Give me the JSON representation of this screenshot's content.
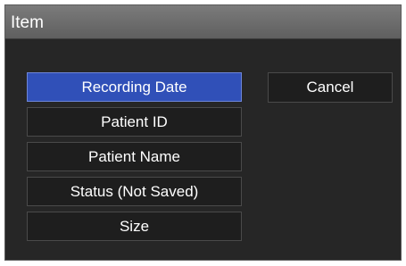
{
  "dialog": {
    "title": "Item",
    "items": [
      {
        "label": "Recording Date",
        "selected": true
      },
      {
        "label": "Patient ID",
        "selected": false
      },
      {
        "label": "Patient Name",
        "selected": false
      },
      {
        "label": "Status (Not Saved)",
        "selected": false
      },
      {
        "label": "Size",
        "selected": false
      }
    ],
    "cancel_label": "Cancel"
  },
  "colors": {
    "dialog_background": "#262626",
    "titlebar": "#6e6e6e",
    "selected_item": "#3050b8",
    "button_background": "#1e1e1e",
    "text": "#ffffff"
  }
}
